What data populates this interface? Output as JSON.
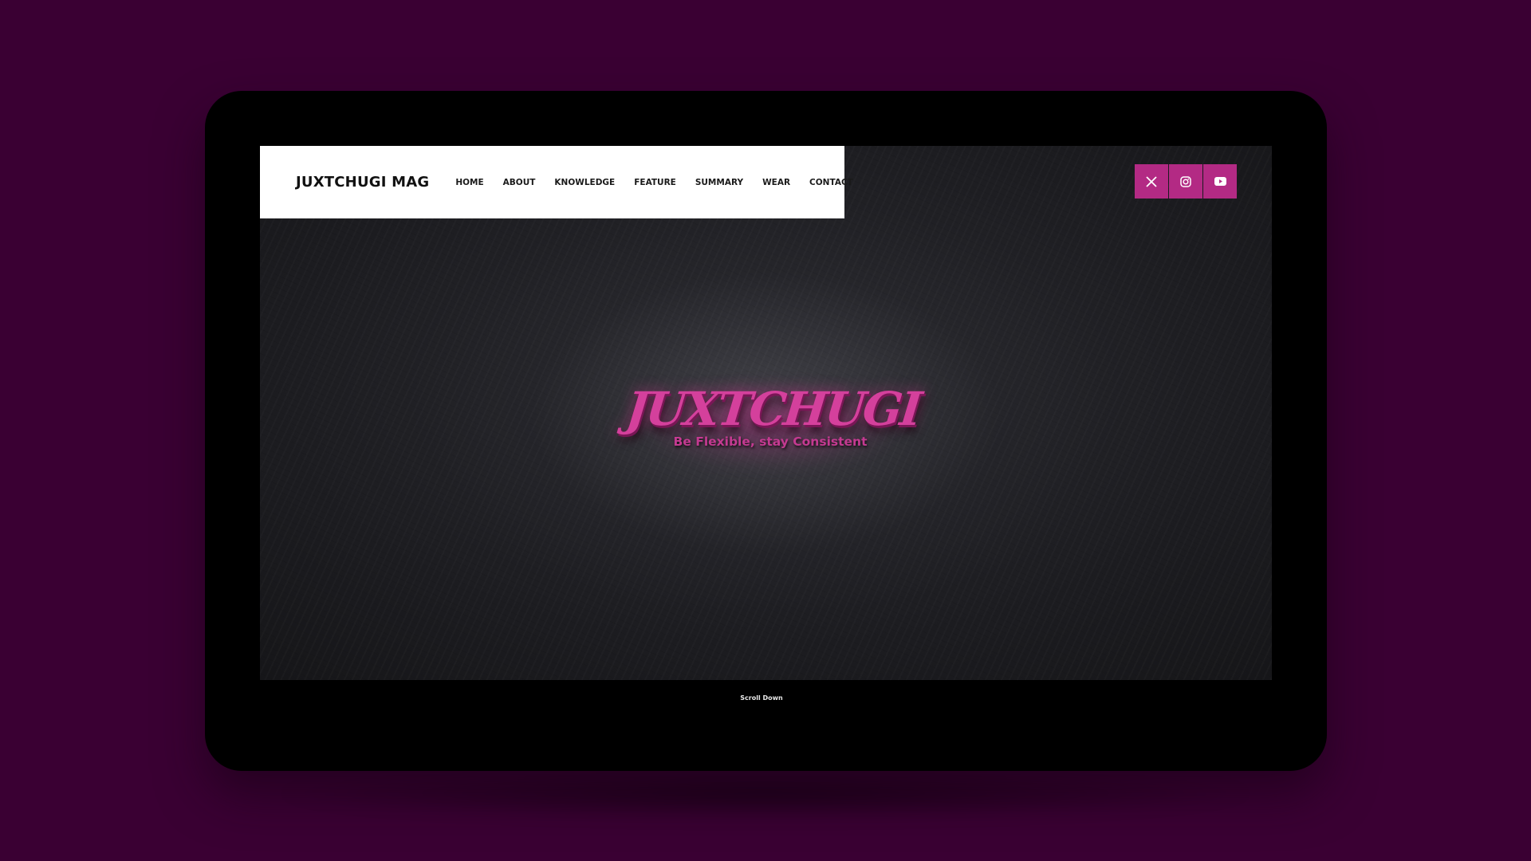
{
  "brand": "JUXTCHUGI MAG",
  "nav": {
    "items": [
      {
        "label": "HOME"
      },
      {
        "label": "ABOUT"
      },
      {
        "label": "KNOWLEDGE"
      },
      {
        "label": "FEATURE"
      },
      {
        "label": "SUMMARY"
      },
      {
        "label": "WEAR"
      },
      {
        "label": "CONTACT"
      }
    ]
  },
  "social": [
    {
      "icon": "x-twitter-icon"
    },
    {
      "icon": "instagram-icon"
    },
    {
      "icon": "youtube-icon"
    }
  ],
  "hero": {
    "logo": "JUXTCHUGI",
    "tagline": "Be Flexible, stay Consistent"
  },
  "scroll_label": "Scroll Down",
  "colors": {
    "background": "#3a0033",
    "accent": "#b32a84",
    "logo_pink": "#d4409c",
    "navbar": "#ffffff",
    "device": "#000000"
  }
}
